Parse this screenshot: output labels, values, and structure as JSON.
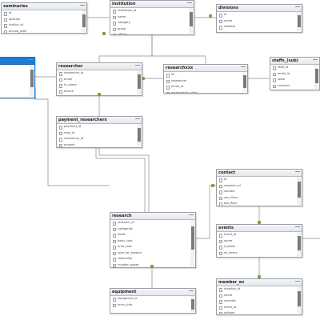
{
  "diagram": {
    "line_color": "#8a8a8a",
    "marker_color": "#7fa13a",
    "selection_color": "#1f7bd4",
    "tables": [
      {
        "id": "seminaries",
        "title": "seminaries",
        "columns": [
          "id",
          "location",
          "institut_id",
          "annual_date",
          "annual_budget"
        ]
      },
      {
        "id": "institution",
        "title": "institution",
        "columns": [
          "institution_id",
          "name",
          "category",
          "group",
          "offices",
          "budget"
        ]
      },
      {
        "id": "divisions",
        "title": "divisions",
        "columns": [
          "id",
          "name",
          "address",
          "phone"
        ]
      },
      {
        "id": "selected",
        "title": "",
        "columns": []
      },
      {
        "id": "researcher",
        "title": "researcher",
        "columns": [
          "researcher_id",
          "email",
          "fu_name",
          "tenure",
          "academic"
        ]
      },
      {
        "id": "researchxxx",
        "title": "researchxxx",
        "columns": [
          "id",
          "researcher",
          "email_id",
          "membership_date"
        ]
      },
      {
        "id": "staffs",
        "title": "staffs_(sub)",
        "columns": [
          "staff_id",
          "email_id",
          "state",
          "contract",
          "roll"
        ]
      },
      {
        "id": "payment",
        "title": "payment_researchers",
        "columns": [
          "payment_id",
          "reay_id",
          "researcher_id",
          "amount",
          "status"
        ]
      },
      {
        "id": "contact",
        "title": "contact",
        "columns": [
          "id",
          "research_id",
          "contact",
          "con_ffxxx",
          "tax_ffxxx"
        ]
      },
      {
        "id": "research",
        "title": "research",
        "columns": [
          "research_id",
          "categories",
          "fields",
          "basic_cost",
          "time_cost",
          "type_for_session",
          "rationality",
          "number_pages",
          "brand_hint"
        ]
      },
      {
        "id": "events",
        "title": "events",
        "columns": [
          "event_id",
          "name",
          "it_fields",
          "ex_forms",
          "obligates"
        ]
      },
      {
        "id": "member",
        "title": "member_ev",
        "columns": [
          "member_id",
          "name",
          "contrast",
          "event_id",
          "oblique"
        ]
      },
      {
        "id": "equipment",
        "title": "equipment",
        "columns": [
          "equipment_id",
          "entry_info"
        ]
      }
    ]
  }
}
